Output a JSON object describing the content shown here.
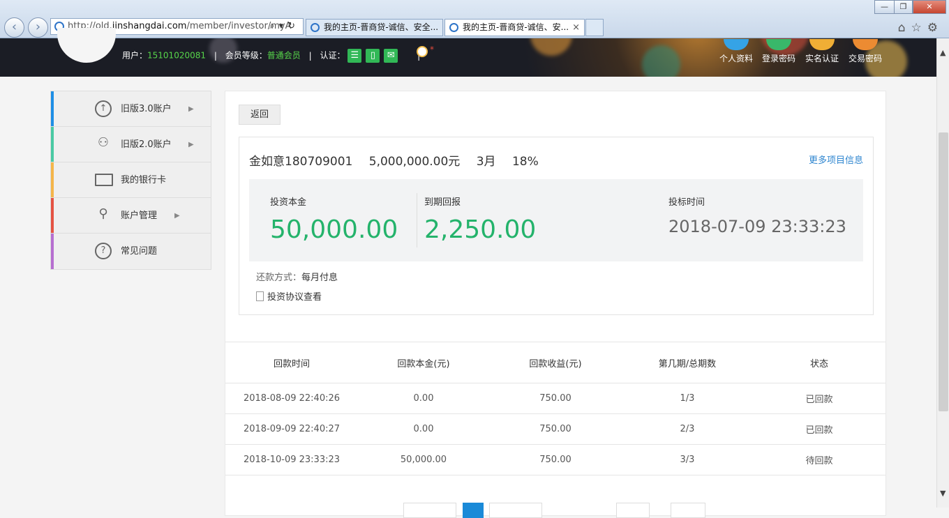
{
  "browser": {
    "url_prefix": "http://old.",
    "url_domain": "jinshangdai.com",
    "url_path": "/member/investor/myA",
    "tabs": [
      {
        "title": "我的主页-晋商贷-诚信、安全..."
      },
      {
        "title": "我的主页-晋商贷-诚信、安..."
      }
    ]
  },
  "header": {
    "user_label": "用户：",
    "user_value": "15101020081",
    "level_label": "会员等级：",
    "level_value": "普通会员",
    "verify_label": "认证：",
    "quick_links": [
      "个人资料",
      "登录密码",
      "实名认证",
      "交易密码"
    ]
  },
  "sidebar": {
    "items": [
      {
        "label": "旧版3.0账户",
        "icon": "arrow-up-circle-icon",
        "color": "#1e8ee5"
      },
      {
        "label": "旧版2.0账户",
        "icon": "users-icon",
        "color": "#49c9a3"
      },
      {
        "label": "我的银行卡",
        "icon": "bank-card-icon",
        "color": "#f4b54a"
      },
      {
        "label": "账户管理",
        "icon": "user-icon",
        "color": "#e45343"
      },
      {
        "label": "常见问题",
        "icon": "question-circle-icon",
        "color": "#b66fd0"
      }
    ]
  },
  "main": {
    "back_label": "返回",
    "product_name": "金如意180709001",
    "amount": "5,000,000.00元",
    "term": "3月",
    "rate": "18%",
    "more_link": "更多项目信息",
    "stats": {
      "principal_label": "投资本金",
      "principal_value": "50,000.00",
      "return_label": "到期回报",
      "return_value": "2,250.00",
      "time_label": "投标时间",
      "time_value": "2018-07-09 23:33:23"
    },
    "repay_label": "还款方式：",
    "repay_value": "每月付息",
    "agreement_label": "投资协议查看"
  },
  "table": {
    "headers": [
      "回款时间",
      "回款本金(元)",
      "回款收益(元)",
      "第几期/总期数",
      "状态"
    ],
    "rows": [
      [
        "2018-08-09 22:40:26",
        "0.00",
        "750.00",
        "1/3",
        "已回款"
      ],
      [
        "2018-09-09 22:40:27",
        "0.00",
        "750.00",
        "2/3",
        "已回款"
      ],
      [
        "2018-10-09 23:33:23",
        "50,000.00",
        "750.00",
        "3/3",
        "待回款"
      ]
    ]
  }
}
